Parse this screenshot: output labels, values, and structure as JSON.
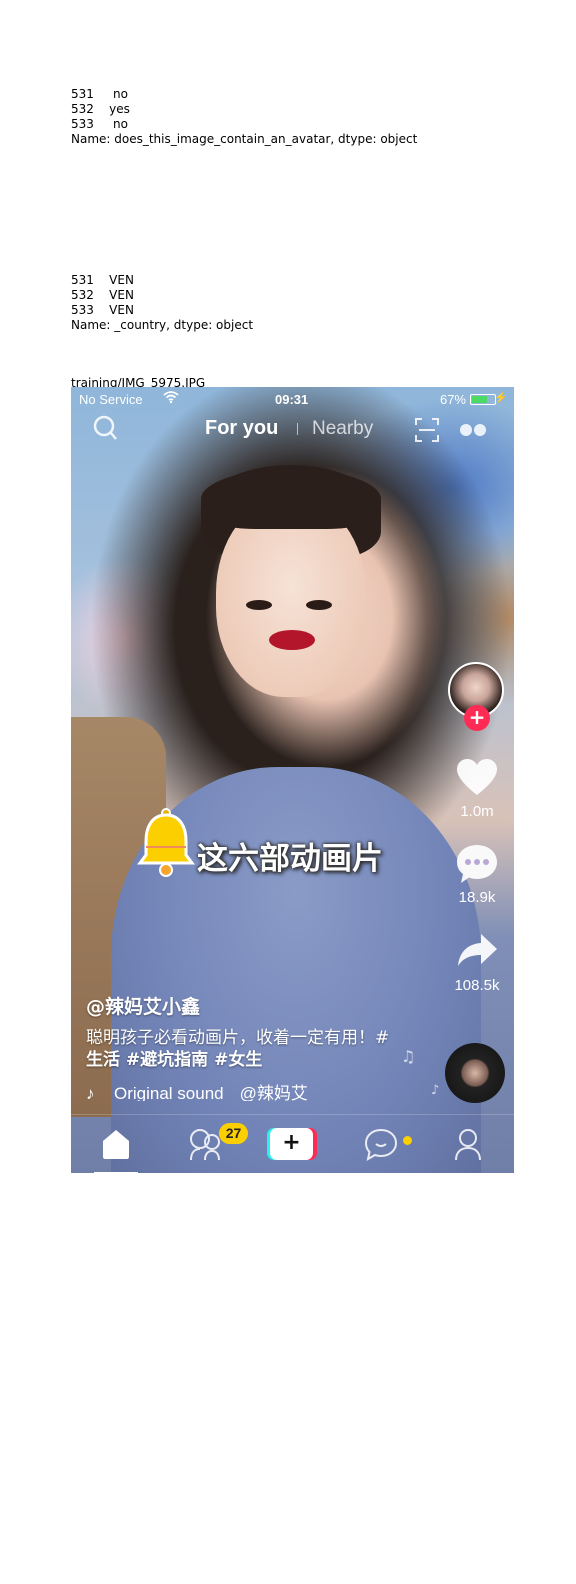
{
  "notebook": {
    "block1": {
      "rows": [
        "531     no",
        "532    yes",
        "533     no"
      ],
      "name_line": "Name: does_this_image_contain_an_avatar, dtype: object"
    },
    "block2": {
      "rows": [
        "531    VEN",
        "532    VEN",
        "533    VEN"
      ],
      "name_line": "Name: _country, dtype: object"
    },
    "filename": "training/IMG_5975.JPG"
  },
  "phone": {
    "status": {
      "carrier": "No Service",
      "time": "09:31",
      "battery_text": "67%",
      "battery_level": 0.67
    },
    "topnav": {
      "foryou_label": "For you",
      "nearby_label": "Nearby"
    },
    "sidebar": {
      "like_count": "1.0m",
      "comment_count": "18.9k",
      "share_count": "108.5k"
    },
    "sticker": {
      "text": "这六部动画片"
    },
    "post": {
      "username": "@辣妈艾小鑫",
      "desc_line1": "聪明孩子必看动画片，收着一定有用！#",
      "desc_line2": "生活 #避坑指南 #女生",
      "sound_title": "Original sound",
      "sound_author": "@辣妈艾"
    },
    "tabbar": {
      "friends_badge": "27",
      "create_symbol": "+"
    },
    "colors": {
      "accent_red": "#fe2c55",
      "accent_cyan": "#25f4ee",
      "badge_yellow": "#fcd000"
    },
    "icons": [
      "search-icon",
      "scan-icon",
      "more-icon",
      "heart-icon",
      "comment-icon",
      "share-icon",
      "bell-icon",
      "music-note-icon",
      "home-icon",
      "friends-icon",
      "inbox-icon",
      "profile-icon"
    ]
  }
}
